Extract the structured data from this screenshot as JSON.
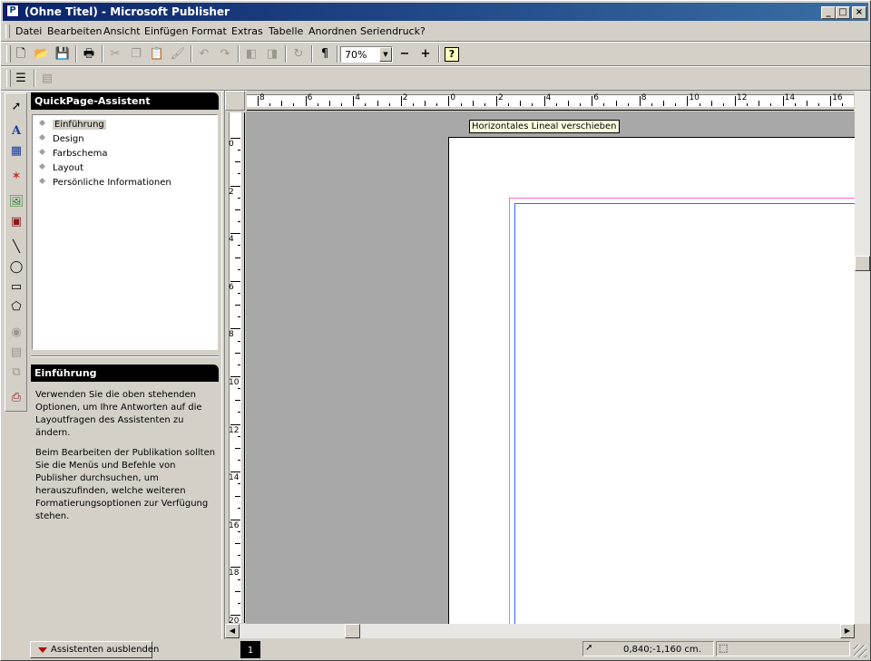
{
  "window": {
    "title": "(Ohne Titel) - Microsoft Publisher",
    "icon_name": "publisher-app-icon",
    "controls": {
      "minimize": "_",
      "maximize": "□",
      "close": "×"
    }
  },
  "menubar": {
    "items": [
      "Datei",
      "Bearbeiten",
      "Ansicht",
      "Einfügen",
      "Format",
      "Extras",
      "Tabelle",
      "Anordnen",
      "Seriendruck",
      "?"
    ]
  },
  "toolbar": {
    "zoom_value": "70%",
    "zoom_out_label": "−",
    "zoom_in_label": "+",
    "paragraph_mark": "¶"
  },
  "wizard_panel": {
    "title": "QuickPage-Assistent",
    "items": [
      "Einführung",
      "Design",
      "Farbschema",
      "Layout",
      "Persönliche Informationen"
    ],
    "selected_index": 0,
    "section_title": "Einführung",
    "description_1": "Verwenden Sie die oben stehenden Optionen, um Ihre Antworten auf die Layoutfragen des  Assistenten zu ändern.",
    "description_2": "Beim Bearbeiten der Publikation sollten Sie die Menüs und Befehle von Publisher durchsuchen, um herauszufinden, welche weiteren Formatierungsoptionen zur Verfügung stehen."
  },
  "ruler": {
    "horizontal_labels": [
      "8",
      "6",
      "4",
      "2",
      "0",
      "2",
      "4",
      "6",
      "8",
      "10",
      "12",
      "14",
      "16"
    ],
    "vertical_labels": [
      "0",
      "2",
      "4",
      "6",
      "8",
      "10",
      "12",
      "14",
      "16",
      "18",
      "20"
    ]
  },
  "tooltip": "Horizontales Lineal verschieben",
  "statusbar": {
    "hide_wizard_label": "Assistenten ausblenden",
    "page_number": "1",
    "coordinates": "0,840;-1,160 cm."
  },
  "colors": {
    "title_gradient_start": "#0a246a",
    "title_gradient_end": "#3a6ea5",
    "workspace": "#a8a8a8",
    "margin_guide_pink": "#ff66cc",
    "margin_guide_blue": "#3366ff",
    "hide_arrow": "#c00000"
  }
}
